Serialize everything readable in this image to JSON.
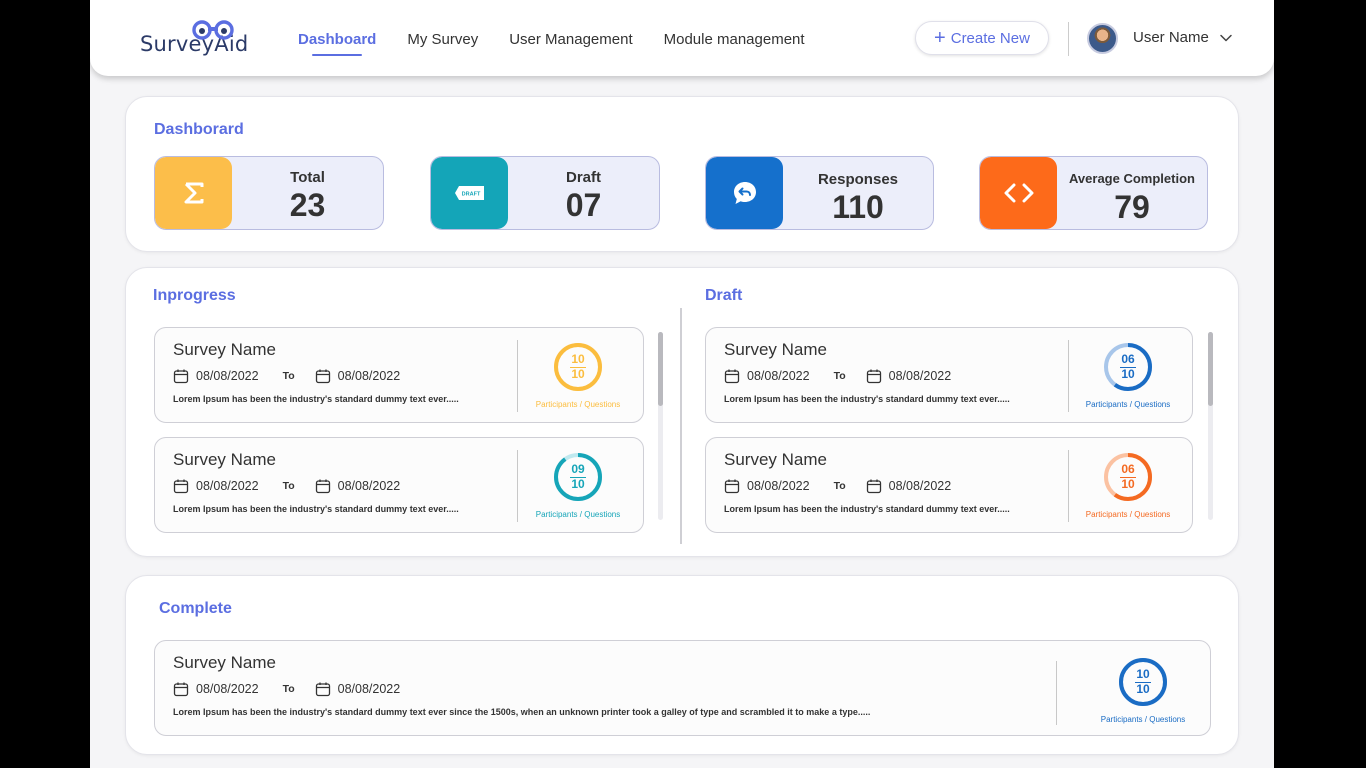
{
  "header": {
    "logo_text": "SurveyAid",
    "nav": [
      {
        "label": "Dashboard",
        "active": true
      },
      {
        "label": "My Survey",
        "active": false
      },
      {
        "label": "User Management",
        "active": false
      },
      {
        "label": "Module management",
        "active": false
      }
    ],
    "create_label": "Create New",
    "user_name": "User Name"
  },
  "dashboard": {
    "title": "Dashborard",
    "stats": [
      {
        "label": "Total",
        "value": "23",
        "color": "#fcbe4a",
        "icon": "sigma-icon"
      },
      {
        "label": "Draft",
        "value": "07",
        "color": "#14a5b8",
        "icon": "draft-tag-icon",
        "icon_text": "DRAFT"
      },
      {
        "label": "Responses",
        "value": "110",
        "color": "#1570cc",
        "icon": "chat-reply-icon"
      },
      {
        "label": "Average Completion",
        "value": "79",
        "color": "#fd6a1a",
        "icon": "code-icon"
      }
    ]
  },
  "inprogress": {
    "title": "Inprogress",
    "items": [
      {
        "name": "Survey Name",
        "start": "08/08/2022",
        "to": "To",
        "end": "08/08/2022",
        "desc": "Lorem Ipsum has been the industry's standard dummy text ever.....",
        "participants": "10",
        "questions": "10",
        "pq_label": "Participants / Questions",
        "color": "#fbbd3e",
        "track": "#fde7b3"
      },
      {
        "name": "Survey Name",
        "start": "08/08/2022",
        "to": "To",
        "end": "08/08/2022",
        "desc": "Lorem Ipsum has been the industry's standard dummy text ever.....",
        "participants": "09",
        "questions": "10",
        "pq_label": "Participants / Questions",
        "color": "#16a5b8",
        "track": "#bfe9ef"
      }
    ]
  },
  "draft": {
    "title": "Draft",
    "items": [
      {
        "name": "Survey Name",
        "start": "08/08/2022",
        "to": "To",
        "end": "08/08/2022",
        "desc": "Lorem Ipsum has been the industry's standard dummy text ever.....",
        "participants": "06",
        "questions": "10",
        "pq_label": "Participants / Questions",
        "color": "#1a6cc4",
        "track": "#a8c6ea"
      },
      {
        "name": "Survey Name",
        "start": "08/08/2022",
        "to": "To",
        "end": "08/08/2022",
        "desc": "Lorem Ipsum has been the industry's standard dummy text ever.....",
        "participants": "06",
        "questions": "10",
        "pq_label": "Participants / Questions",
        "color": "#f46a22",
        "track": "#fbc2a2"
      }
    ]
  },
  "complete": {
    "title": "Complete",
    "items": [
      {
        "name": "Survey Name",
        "start": "08/08/2022",
        "to": "To",
        "end": "08/08/2022",
        "desc": "Lorem Ipsum has been the industry's standard dummy text ever since the 1500s, when an unknown printer took a galley of type and scrambled it to make a type.....",
        "participants": "10",
        "questions": "10",
        "pq_label": "Participants / Questions",
        "color": "#1a6cc4",
        "track": "#a8c6ea"
      }
    ]
  }
}
